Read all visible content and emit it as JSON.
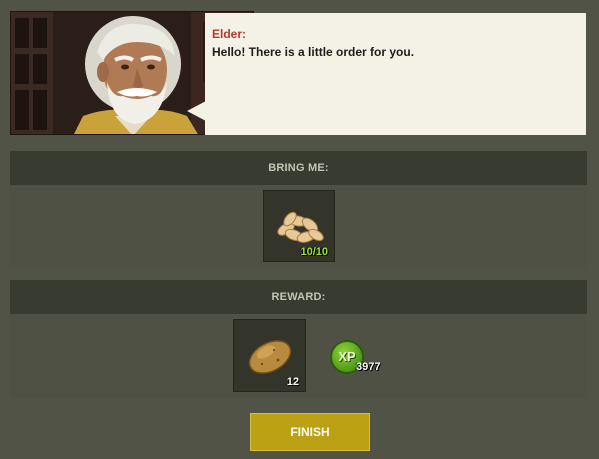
{
  "dialog": {
    "speaker": "Elder:",
    "message": "Hello! There is a little order for you."
  },
  "request": {
    "header": "BRING ME:",
    "items": [
      {
        "icon": "seeds-icon",
        "count": "10/10"
      }
    ]
  },
  "reward": {
    "header": "REWARD:",
    "items": [
      {
        "icon": "potato-icon",
        "count": "12"
      }
    ],
    "xp": {
      "icon": "xp-icon",
      "label": "XP",
      "amount": "3977"
    }
  },
  "actions": {
    "finish_label": "FINISH"
  },
  "colors": {
    "background": "#505345",
    "section_header": "#383b2f",
    "bubble": "#f4f1e6",
    "speaker": "#b53a2c",
    "finish_button": "#bda114",
    "count_complete": "#9be13a",
    "xp_badge": "#5fae1f"
  }
}
